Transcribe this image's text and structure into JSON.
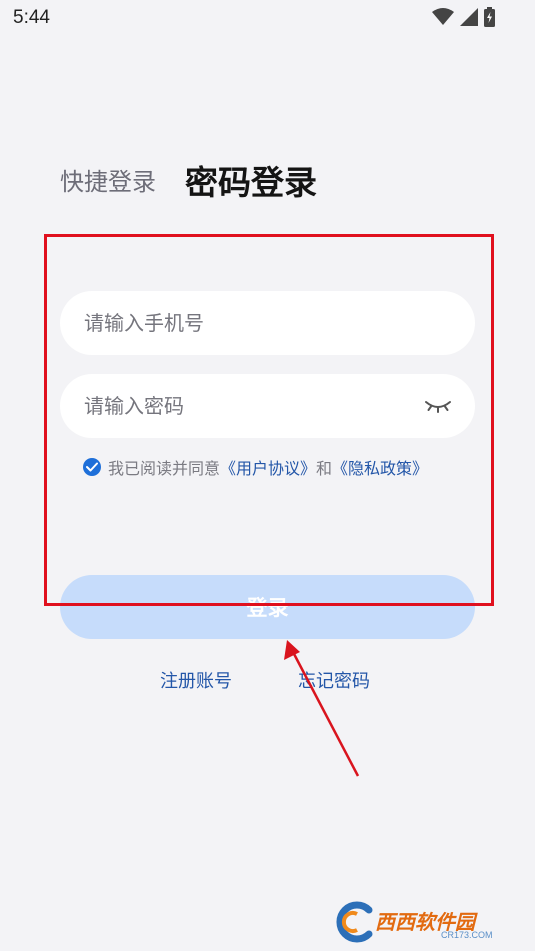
{
  "status_bar": {
    "time": "5:44"
  },
  "tabs": {
    "quick_login": "快捷登录",
    "password_login": "密码登录"
  },
  "form": {
    "phone_placeholder": "请输入手机号",
    "password_placeholder": "请输入密码"
  },
  "agreement": {
    "checked": true,
    "prefix": "我已阅读并同意",
    "user_agreement": "《用户协议》",
    "conjunction": "和",
    "privacy_policy": "《隐私政策》"
  },
  "login_button": "登录",
  "links": {
    "register": "注册账号",
    "forgot_password": "忘记密码"
  },
  "watermark": {
    "brand": "西西软件园",
    "domain": "CR173.COM"
  },
  "colors": {
    "background": "#f3f3f6",
    "accent": "#1e6fd9",
    "link": "#2356a8",
    "button_disabled": "#c6dcfb",
    "annotation": "#e0101e"
  }
}
